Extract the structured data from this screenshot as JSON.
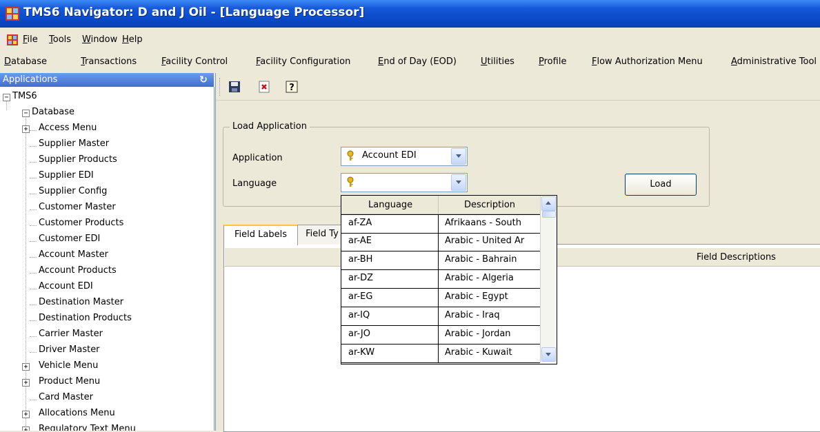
{
  "window": {
    "title": "TMS6 Navigator: D and J Oil - [Language Processor]"
  },
  "menu_top": [
    {
      "label": "File"
    },
    {
      "label": "Tools"
    },
    {
      "label": "Window"
    },
    {
      "label": "Help"
    }
  ],
  "menu_main": [
    {
      "label": "Database"
    },
    {
      "label": "Transactions"
    },
    {
      "label": "Facility Control"
    },
    {
      "label": "Facility Configuration"
    },
    {
      "label": "End of Day (EOD)"
    },
    {
      "label": "Utilities"
    },
    {
      "label": "Profile"
    },
    {
      "label": "Flow Authorization Menu"
    },
    {
      "label": "Administrative Tool"
    }
  ],
  "sidebar": {
    "header": "Applications",
    "root": "TMS6",
    "database": "Database",
    "items": [
      {
        "label": "Access Menu",
        "expandable": true
      },
      {
        "label": "Supplier Master"
      },
      {
        "label": "Supplier Products"
      },
      {
        "label": "Supplier EDI"
      },
      {
        "label": "Supplier Config"
      },
      {
        "label": "Customer Master"
      },
      {
        "label": "Customer Products"
      },
      {
        "label": "Customer EDI"
      },
      {
        "label": "Account Master"
      },
      {
        "label": "Account Products"
      },
      {
        "label": "Account EDI"
      },
      {
        "label": "Destination Master"
      },
      {
        "label": "Destination Products"
      },
      {
        "label": "Carrier Master"
      },
      {
        "label": "Driver Master"
      },
      {
        "label": "Vehicle Menu",
        "expandable": true
      },
      {
        "label": "Product Menu",
        "expandable": true
      },
      {
        "label": "Card Master"
      },
      {
        "label": "Allocations Menu",
        "expandable": true
      },
      {
        "label": "Regulatory Text Menu",
        "expandable": true
      }
    ]
  },
  "toolbar": {
    "icons": [
      "save-icon",
      "delete-icon",
      "help-icon"
    ]
  },
  "load_application": {
    "legend": "Load Application",
    "application_label": "Application",
    "application_value": "Account EDI",
    "language_label": "Language",
    "language_value": "",
    "load_button": "Load"
  },
  "tabs": [
    {
      "label": "Field Labels"
    },
    {
      "label": "Field Ty"
    }
  ],
  "grid": {
    "field_descriptions_header": "Field Descriptions"
  },
  "dropdown": {
    "col_language": "Language",
    "col_description": "Description",
    "rows": [
      {
        "code": "af-ZA",
        "desc": "Afrikaans - South"
      },
      {
        "code": "ar-AE",
        "desc": "Arabic - United Ar"
      },
      {
        "code": "ar-BH",
        "desc": "Arabic - Bahrain"
      },
      {
        "code": "ar-DZ",
        "desc": "Arabic - Algeria"
      },
      {
        "code": "ar-EG",
        "desc": "Arabic - Egypt"
      },
      {
        "code": "ar-IQ",
        "desc": "Arabic - Iraq"
      },
      {
        "code": "ar-JO",
        "desc": "Arabic - Jordan"
      },
      {
        "code": "ar-KW",
        "desc": "Arabic - Kuwait"
      }
    ]
  }
}
